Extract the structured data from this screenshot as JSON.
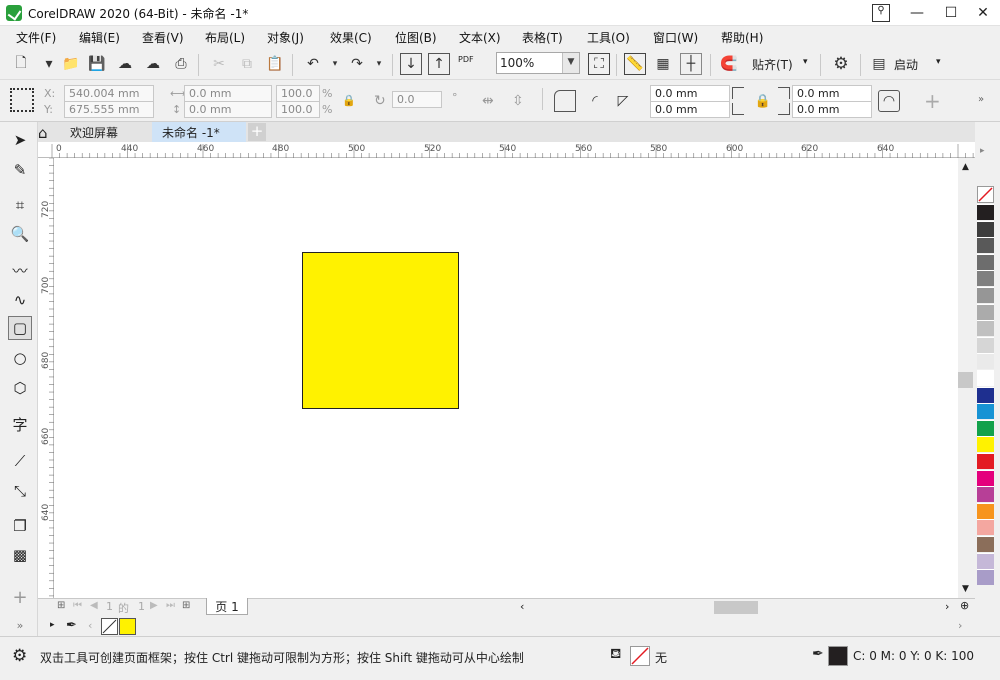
{
  "window": {
    "title": "CorelDRAW 2020 (64-Bit) - 未命名 -1*",
    "minimize": "—",
    "maximize": "☐",
    "close": "✕"
  },
  "menu": [
    "文件(F)",
    "编辑(E)",
    "查看(V)",
    "布局(L)",
    "对象(J)",
    "效果(C)",
    "位图(B)",
    "文本(X)",
    "表格(T)",
    "工具(O)",
    "窗口(W)",
    "帮助(H)"
  ],
  "toolbar": {
    "zoom_value": "100%",
    "snap_label": "贴齐(T)",
    "launch_label": "启动",
    "pdf_label": "PDF"
  },
  "property_bar": {
    "x_label": "X:",
    "y_label": "Y:",
    "x_value": "540.004 mm",
    "y_value": "675.555 mm",
    "width_value": "0.0 mm",
    "height_value": "0.0 mm",
    "scale_x": "100.0",
    "scale_y": "100.0",
    "percent": "%",
    "rotation": "0.0",
    "degree": "°",
    "corner_tl": "0.0 mm",
    "corner_bl": "0.0 mm",
    "corner_tr": "0.0 mm",
    "corner_br": "0.0 mm"
  },
  "tabs": {
    "welcome": "欢迎屏幕",
    "document": "未命名 -1*",
    "add": "+"
  },
  "ruler": {
    "h_labels": [
      "0",
      "440",
      "460",
      "480",
      "500",
      "520",
      "540",
      "560",
      "580",
      "600",
      "620",
      "640"
    ],
    "v_labels": [
      "720",
      "700",
      "680",
      "660",
      "640"
    ]
  },
  "page_nav": {
    "current": "1",
    "of": "的",
    "total": "1",
    "page_tab": "页 1"
  },
  "status": {
    "hint": "双击工具可创建页面框架；按住 Ctrl 键拖动可限制为方形；按住 Shift 键拖动可从中心绘制",
    "fill_none": "无",
    "cmyk": "C:   0 M:   0 Y:   0 K:  100"
  },
  "colors": {
    "shape_fill": "#fff200",
    "palette": [
      "#231f20",
      "#3d3d3d",
      "#595959",
      "#6d6d6d",
      "#808080",
      "#969696",
      "#ababab",
      "#c0c0c0",
      "#d6d6d6",
      "#eaeaea",
      "#ffffff",
      "#1e2f8f",
      "#1793d4",
      "#12a14b",
      "#fff200",
      "#e31b23",
      "#e4007d",
      "#b73f97",
      "#f7941d",
      "#f4a7a0",
      "#8b6e5a",
      "#c5b8d8",
      "#a89cc8"
    ]
  }
}
